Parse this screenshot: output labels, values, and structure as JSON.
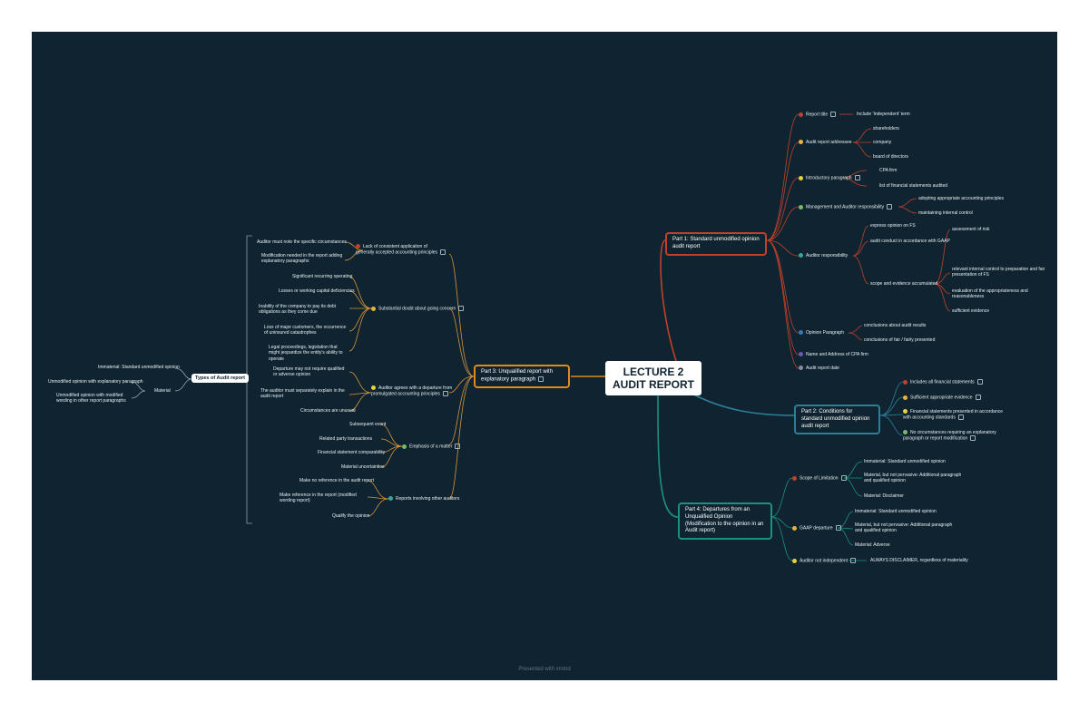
{
  "center": {
    "line1": "LECTURE 2",
    "line2": "AUDIT REPORT"
  },
  "footer": "Presented with xmind",
  "colors": {
    "background": "#0f2430",
    "part1": "#c0412a",
    "part2": "#2e7e98",
    "part3": "#e08a1e",
    "part4": "#1e8f80",
    "orange_link": "#d6953a",
    "teal_link": "#2f9a8a",
    "red_link": "#c0412a"
  },
  "part1": {
    "title": "Part 1: Standard unmodified opinion audit report",
    "items": {
      "report_title": "Report title",
      "independent_term": "Include 'Independent' term",
      "addressee": "Audit report addressee",
      "shareholders": "shareholders",
      "company": "company",
      "board": "board of directors",
      "intro": "Introductory paragraph",
      "cpa_firm": "CPA firm",
      "fs_list": "list of financial statements audited",
      "mgmt": "Management and Auditor responsibility",
      "adopting": "adopting appropriate accounting principles",
      "maintain": "maintaining internal control",
      "auditor_resp": "Auditor responsibility",
      "express": "express opinion on FS",
      "conduct": "audit conduct in accordance with GAAP",
      "scope": "scope and evidence accumulated",
      "assessment": "assessment of risk",
      "relevant": "relevant internal control to preparation and fair presentation of FS",
      "evaluation": "evaluation of the appropriateness and reasonableness",
      "sufficient": "sufficient evidence",
      "opinion_para": "Opinion Paragraph",
      "conclusion": "conclusions about audit results",
      "fair": "conclusions of fair / fairly presented",
      "name": "Name and Address of CPA firm",
      "date": "Audit report date"
    }
  },
  "part2": {
    "title": "Part 2: Conditions for standard unmodified opinion audit report",
    "items": {
      "c1": "Includes all financial statements",
      "c2": "Sufficient appropriate evidence",
      "c3": "Financial statements presented in accordance with accounting standards",
      "c4": "No circumstances requiring an explanatory paragraph or report modification"
    }
  },
  "part3": {
    "title": "Part 3: Unqualified report with explanatory paragraph",
    "items": {
      "lack": "Lack of consistent application of generally accepted accounting principles",
      "lack_a": "Auditor must note the specific circumstances",
      "lack_b": "Modification needed in the report adding explanatory paragraphs",
      "doubt": "Substantial doubt about going concern",
      "doubt_a": "Significant recurring operating",
      "doubt_b": "Losses or working capital deficiencies",
      "doubt_c": "Inability of the company to pay its debt obligations as they come due",
      "doubt_d": "Loss of major customers, the occurrence of uninsured catastrophes",
      "doubt_e": "Legal proceedings, legislation that might jeopardize the entity's ability to operate",
      "departure": "Auditor agrees with a departure from promulgated accounting principles",
      "dep_a": "Departure may not require qualified or adverse opinion",
      "dep_b": "The auditor must separately explain in the audit report",
      "dep_c": "Circumstances are unusual",
      "emphasis": "Emphasis of a matter",
      "emp_a": "Subsequent event",
      "emp_b": "Related party transactions",
      "emp_c": "Financial statement comparability",
      "emp_d": "Material uncertainties",
      "other": "Reports involving other auditors",
      "oth_a": "Make no reference in the audit report",
      "oth_b": "Make reference in the report (modified wording report)",
      "oth_c": "Qualify the opinion"
    }
  },
  "types": {
    "title": "Types of Audit report",
    "immaterial": "Immaterial: Standard unmodified opinion",
    "material": "Material",
    "mat_a": "Unmodified opinion with explanatory paragraph",
    "mat_b": "Unmodified opinion with modified wording in other report paragraphs"
  },
  "part4": {
    "title": "Part 4: Departures from an Unqualified Opinion (Modification to the opinion in an Audit report)",
    "items": {
      "scope": "Scope of Limitation",
      "s_a": "Immaterial: Standard unmodified opinion",
      "s_b": "Material, but not pervasive: Additional paragraph and qualified opinion",
      "s_c": "Material: Disclaimer",
      "gaap": "GAAP departure",
      "g_a": "Immaterial: Standard unmodified opinion",
      "g_b": "Material, but not pervasive: Additional paragraph and qualified opinion",
      "g_c": "Material: Adverse",
      "indep": "Auditor not independent",
      "i_a": "ALWAYS DISCLAIMER, regardless of materiality"
    }
  }
}
